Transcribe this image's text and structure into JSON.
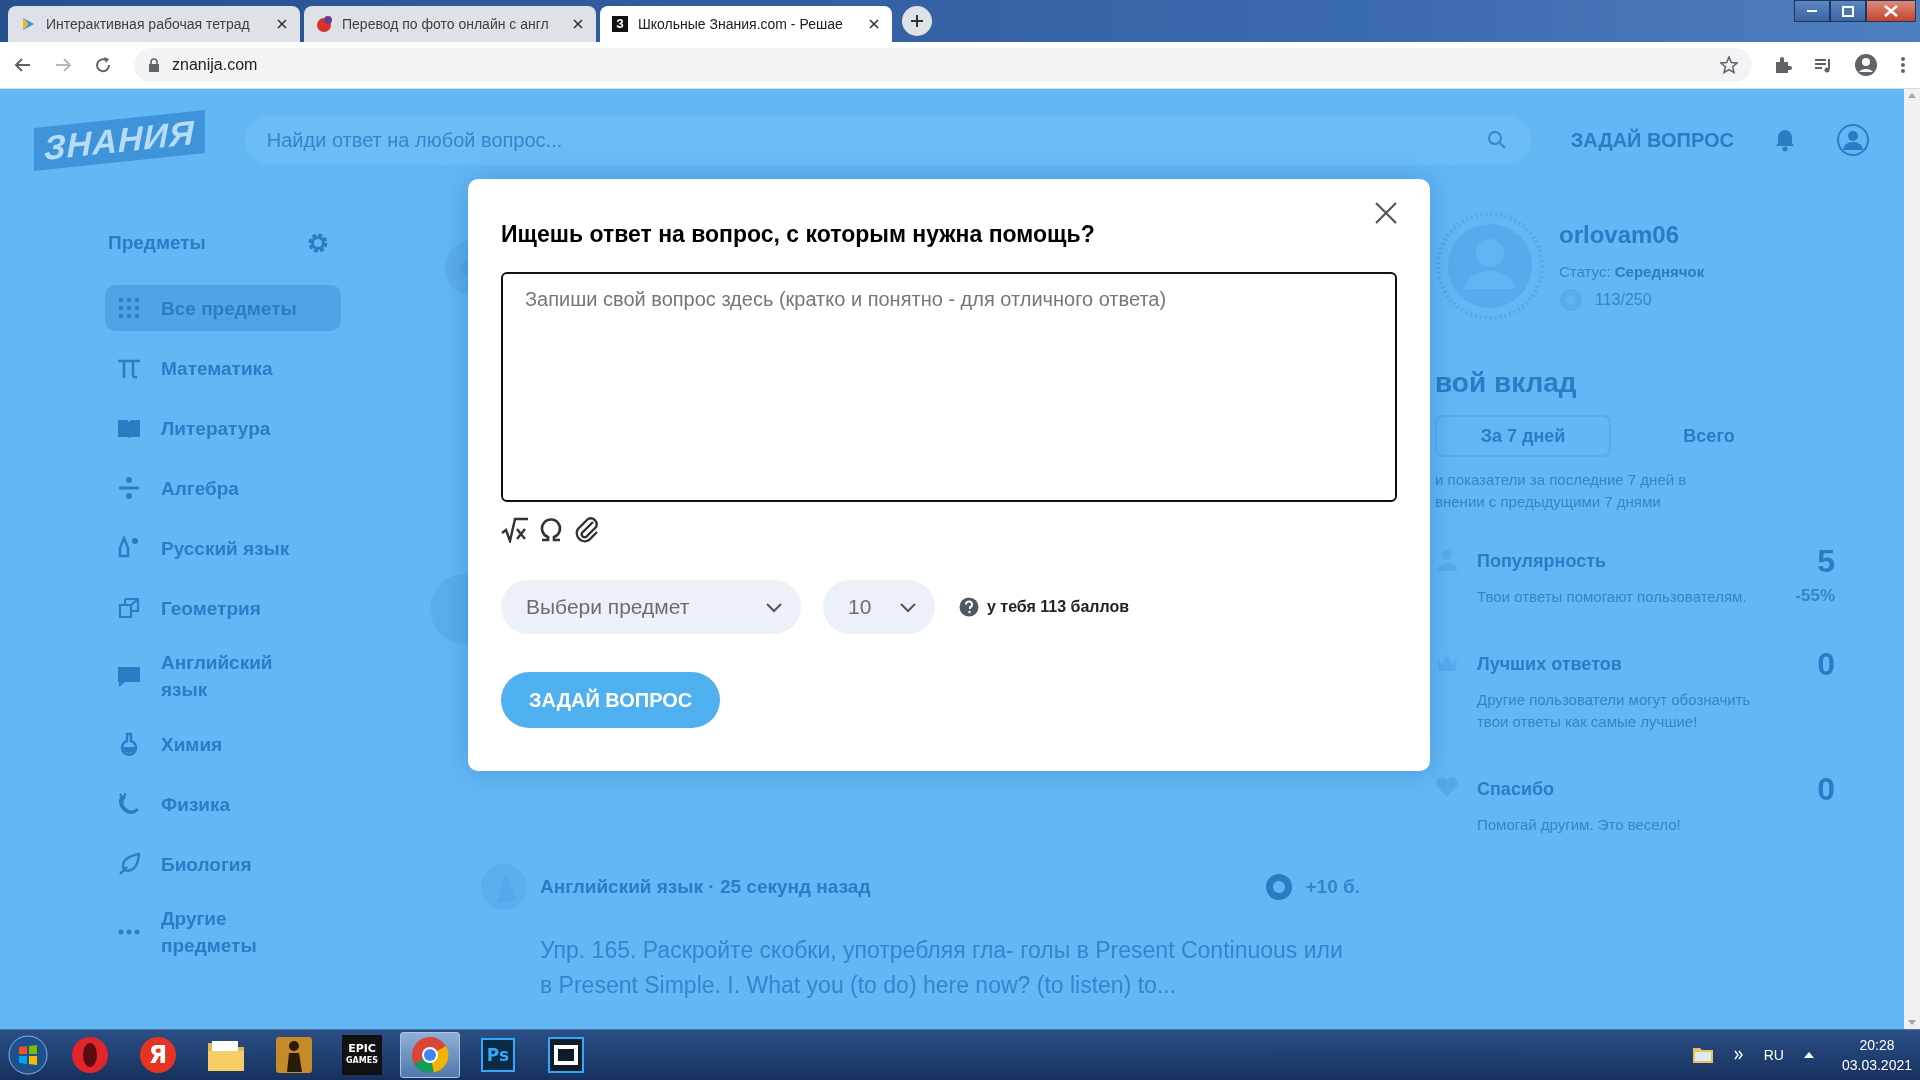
{
  "browser": {
    "tabs": [
      {
        "title": "Интерактивная рабочая тетрад",
        "selected": false
      },
      {
        "title": "Перевод по фото онлайн с англ",
        "selected": false
      },
      {
        "title": "Школьные Знания.com - Решае",
        "selected": true,
        "favicon_text": "З"
      }
    ],
    "address": "znanija.com"
  },
  "header": {
    "logo": "ЗНАНИЯ",
    "search_placeholder": "Найди ответ на любой вопрос...",
    "ask_button": "ЗАДАЙ ВОПРОС"
  },
  "sidebar": {
    "title": "Предметы",
    "items": [
      {
        "label": "Все предметы",
        "selected": true
      },
      {
        "label": "Математика",
        "selected": false
      },
      {
        "label": "Литература",
        "selected": false
      },
      {
        "label": "Алгебра",
        "selected": false
      },
      {
        "label": "Русский язык",
        "selected": false
      },
      {
        "label": "Геометрия",
        "selected": false
      },
      {
        "label": "Английский язык",
        "selected": false
      },
      {
        "label": "Химия",
        "selected": false
      },
      {
        "label": "Физика",
        "selected": false
      },
      {
        "label": "Биология",
        "selected": false
      },
      {
        "label": "Другие предметы",
        "selected": false
      }
    ]
  },
  "feed": {
    "question": {
      "meta": "Английский язык · 25 секунд назад",
      "points": "+10 б.",
      "text": "Упр. 165. Раскройте скобки, употребляя гла- голы в Present Continuous или в Present Simple. I. What you (to do) here now? (to listen) to..."
    }
  },
  "profile": {
    "username": "orlovam06",
    "status": "Статус: **Середнячок**",
    "points": "113/250",
    "contribution_title": "вой вклад",
    "tabs": [
      {
        "label": "За 7 дней",
        "selected": true
      },
      {
        "label": "Всего",
        "selected": false
      }
    ],
    "description_lines": [
      "и показатели за последние 7 дней в",
      "внении с предыдущими 7 днями"
    ],
    "stats": [
      {
        "title": "Популярность",
        "value": "5",
        "change": "-55%",
        "text": "Твои ответы помогают пользователям."
      },
      {
        "title": "Лучших ответов",
        "value": "0",
        "text": "Другие пользователи могут обозначить твои ответы как самые лучшие!"
      },
      {
        "title": "Спасибо",
        "value": "0",
        "text": "Помогай другим. Это весело!"
      }
    ]
  },
  "modal": {
    "title": "Ищешь ответ на вопрос, с которым нужна помощь?",
    "placeholder": "Запиши свой вопрос здесь (кратко и понятно - для отличного ответа)",
    "subject_select": "Выбери предмет",
    "points_select": "10",
    "points_note": "у тебя 113 баллов",
    "submit": "ЗАДАЙ ВОПРОС"
  },
  "taskbar": {
    "apps": [
      {
        "kind": "start",
        "selected": false
      },
      {
        "kind": "opera",
        "selected": false
      },
      {
        "kind": "yandex",
        "label": "Я",
        "selected": false
      },
      {
        "kind": "folder",
        "selected": false
      },
      {
        "kind": "soldier",
        "selected": false
      },
      {
        "kind": "epic",
        "label": "EPIC",
        "sublabel": "GAMES",
        "selected": false
      },
      {
        "kind": "chrome",
        "selected": true
      },
      {
        "kind": "photoshop",
        "label": "Ps",
        "selected": false
      },
      {
        "kind": "film",
        "selected": false
      }
    ],
    "language": "RU",
    "time": "20:28",
    "date": "03.03.2021"
  }
}
